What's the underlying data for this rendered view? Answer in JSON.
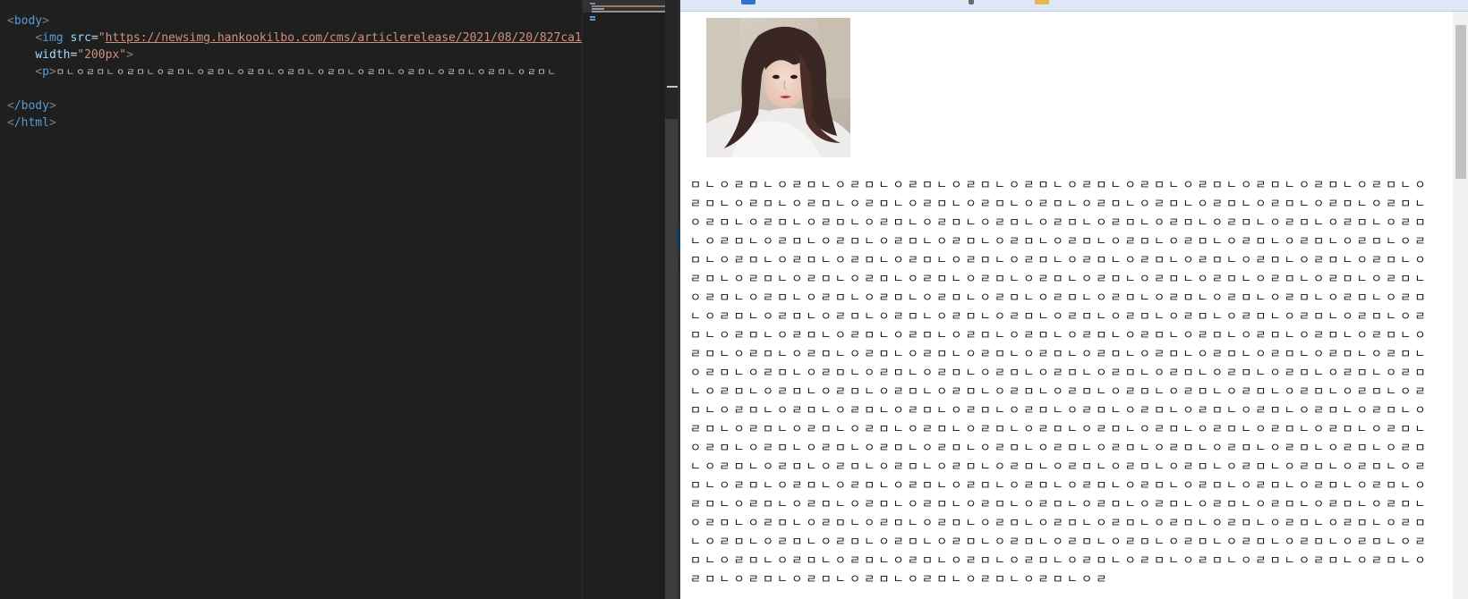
{
  "editor": {
    "lines": {
      "body_open": "body",
      "img_tag": "img",
      "src_attr": "src",
      "src_value": "https://newsimg.hankookilbo.com/cms/articlerelease/2021/08/20/827ca1e8",
      "width_attr": "width",
      "width_value": "\"200px\"",
      "p_tag": "p",
      "p_text": "ㅁㄴㅇㄹㅁㄴㅇㄹㅁㄴㅇㄹㅁㄴㅇㄹㅁㄴㅇㄹㅁㄴㅇㄹㅁㄴㅇㄹㅁㄴㅇㄹㅁㄴㅇㄹㅁㄴㅇㄹㅁㄴㅇㄹㅁㄴㅇㄹㅁㄴ",
      "body_close": "/body",
      "html_close": "/html"
    }
  },
  "preview": {
    "paragraph_text": "ㅁㄴㅇㄹㅁㄴㅇㄹㅁㄴㅇㄹㅁㄴㅇㄹㅁㄴㅇㄹㅁㄴㅇㄹㅁㄴㅇㄹㅁㄴㅇㄹㅁㄴㅇㄹㅁㄴㅇㄹㅁㄴㅇㄹㅁㄴㅇㄹㅁㄴㅇㄹㅁㄴㅇㄹㅁㄴㅇㄹㅁㄴㅇㄹㅁㄴㅇㄹㅁㄴㅇㄹㅁㄴㅇㄹㅁㄴㅇㄹㅁㄴㅇㄹㅁㄴㅇㄹㅁㄴㅇㄹㅁㄴㅇㄹㅁㄴㅇㄹㅁㄴㅇㄹㅁㄴㅇㄹㅁㄴㅇㄹㅁㄴㅇㄹㅁㄴㅇㄹㅁㄴㅇㄹㅁㄴㅇㄹㅁㄴㅇㄹㅁㄴㅇㄹㅁㄴㅇㄹㅁㄴㅇㄹㅁㄴㅇㄹㅁㄴㅇㄹㅁㄴㅇㄹㅁㄴㅇㄹㅁㄴㅇㄹㅁㄴㅇㄹㅁㄴㅇㄹㅁㄴㅇㄹㅁㄴㅇㄹㅁㄴㅇㄹㅁㄴㅇㄹㅁㄴㅇㄹㅁㄴㅇㄹㅁㄴㅇㄹㅁㄴㅇㄹㅁㄴㅇㄹㅁㄴㅇㄹㅁㄴㅇㄹㅁㄴㅇㄹㅁㄴㅇㄹㅁㄴㅇㄹㅁㄴㅇㄹㅁㄴㅇㄹㅁㄴㅇㄹㅁㄴㅇㄹㅁㄴㅇㄹㅁㄴㅇㄹㅁㄴㅇㄹㅁㄴㅇㄹㅁㄴㅇㄹㅁㄴㅇㄹㅁㄴㅇㄹㅁㄴㅇㄹㅁㄴㅇㄹㅁㄴㅇㄹㅁㄴㅇㄹㅁㄴㅇㄹㅁㄴㅇㄹㅁㄴㅇㄹㅁㄴㅇㄹㅁㄴㅇㄹㅁㄴㅇㄹㅁㄴㅇㄹㅁㄴㅇㄹㅁㄴㅇㄹㅁㄴㅇㄹㅁㄴㅇㄹㅁㄴㅇㄹㅁㄴㅇㄹㅁㄴㅇㄹㅁㄴㅇㄹㅁㄴㅇㄹㅁㄴㅇㄹㅁㄴㅇㄹㅁㄴㅇㄹㅁㄴㅇㄹㅁㄴㅇㄹㅁㄴㅇㄹㅁㄴㅇㄹㅁㄴㅇㄹㅁㄴㅇㄹㅁㄴㅇㄹㅁㄴㅇㄹㅁㄴㅇㄹㅁㄴㅇㄹㅁㄴㅇㄹㅁㄴㅇㄹㅁㄴㅇㄹㅁㄴㅇㄹㅁㄴㅇㄹㅁㄴㅇㄹㅁㄴㅇㄹㅁㄴㅇㄹㅁㄴㅇㄹㅁㄴㅇㄹㅁㄴㅇㄹㅁㄴㅇㄹㅁㄴㅇㄹㅁㄴㅇㄹㅁㄴㅇㄹㅁㄴㅇㄹㅁㄴㅇㄹㅁㄴㅇㄹㅁㄴㅇㄹㅁㄴㅇㄹㅁㄴㅇㄹㅁㄴㅇㄹㅁㄴㅇㄹㅁㄴㅇㄹㅁㄴㅇㄹㅁㄴㅇㄹㅁㄴㅇㄹㅁㄴㅇㄹㅁㄴㅇㄹㅁㄴㅇㄹㅁㄴㅇㄹㅁㄴㅇㄹㅁㄴㅇㄹㅁㄴㅇㄹㅁㄴㅇㄹㅁㄴㅇㄹㅁㄴㅇㄹㅁㄴㅇㄹㅁㄴㅇㄹㅁㄴㅇㄹㅁㄴㅇㄹㅁㄴㅇㄹㅁㄴㅇㄹㅁㄴㅇㄹㅁㄴㅇㄹㅁㄴㅇㄹㅁㄴㅇㄹㅁㄴㅇㄹㅁㄴㅇㄹㅁㄴㅇㄹㅁㄴㅇㄹㅁㄴㅇㄹㅁㄴㅇㄹㅁㄴㅇㄹㅁㄴㅇㄹㅁㄴㅇㄹㅁㄴㅇㄹㅁㄴㅇㄹㅁㄴㅇㄹㅁㄴㅇㄹㅁㄴㅇㄹㅁㄴㅇㄹㅁㄴㅇㄹㅁㄴㅇㄹㅁㄴㅇㄹㅁㄴㅇㄹㅁㄴㅇㄹㅁㄴㅇㄹㅁㄴㅇㄹㅁㄴㅇㄹㅁㄴㅇㄹㅁㄴㅇㄹㅁㄴㅇㄹㅁㄴㅇㄹㅁㄴㅇㄹㅁㄴㅇㄹㅁㄴㅇㄹㅁㄴㅇㄹㅁㄴㅇㄹㅁㄴㅇㄹㅁㄴㅇㄹㅁㄴㅇㄹㅁㄴㅇㄹㅁㄴㅇㄹㅁㄴㅇㄹㅁㄴㅇㄹㅁㄴㅇㄹㅁㄴㅇㄹㅁㄴㅇㄹㅁㄴㅇㄹㅁㄴㅇㄹㅁㄴㅇㄹㅁㄴㅇㄹㅁㄴㅇㄹㅁㄴㅇㄹㅁㄴㅇㄹㅁㄴㅇㄹㅁㄴㅇㄹㅁㄴㅇㄹㅁㄴㅇㄹㅁㄴㅇㄹㅁㄴㅇㄹㅁㄴㅇㄹㅁㄴㅇㄹㅁㄴㅇㄹㅁㄴㅇㄹㅁㄴㅇㄹㅁㄴㅇㄹㅁㄴㅇㄹㅁㄴㅇㄹㅁㄴㅇㄹㅁㄴㅇㄹㅁㄴㅇㄹㅁㄴㅇㄹㅁㄴㅇㄹㅁㄴㅇㄹㅁㄴㅇㄹㅁㄴㅇㄹㅁㄴㅇㄹㅁㄴㅇㄹㅁㄴㅇㄹㅁㄴㅇㄹㅁㄴㅇㄹㅁㄴㅇㄹㅁㄴㅇㄹㅁㄴㅇㄹㅁㄴㅇㄹㅁㄴㅇㄹㅁㄴㅇㄹㅁㄴㅇㄹㅁㄴㅇㄹㅁㄴㅇㄹㅁㄴㅇㄹㅁㄴㅇㄹㅁㄴㅇㄹㅁㄴㅇㄹㅁㄴㅇㄹㅁㄴㅇㄹㅁㄴㅇㄹㅁㄴㅇㄹㅁㄴㅇㄹㅁㄴㅇㄹㅁㄴㅇㄹㅁㄴㅇㄹㅁㄴㅇㄹㅁㄴㅇㄹㅁㄴㅇㄹㅁㄴㅇㄹㅁㄴㅇㄹㅁㄴㅇㄹㅁㄴㅇㄹㅁㄴㅇㄹㅁㄴㅇㄹㅁㄴㅇㄹㅁㄴㅇㄹㅁㄴㅇㄹㅁㄴㅇㄹㅁㄴㅇㄹㅁㄴㅇㄹㅁㄴㅇㄹㅁㄴㅇㄹㅁㄴㅇㄹㅁㄴㅇㄹㅁㄴㅇㄹㅁㄴㅇㄹㅁㄴㅇㄹㅁㄴㅇㄹㅁㄴㅇㄹㅁㄴㅇㄹㅁㄴㅇㄹㅁㄴㅇㄹㅁㄴㅇㄹㅁㄴㅇㄹㅁㄴㅇㄹ"
  },
  "colors": {
    "editor_bg": "#1f1f1f",
    "tag": "#569cd6",
    "attribute": "#9cdcfe",
    "string": "#ce9178",
    "preview_bg": "#ffffff"
  }
}
